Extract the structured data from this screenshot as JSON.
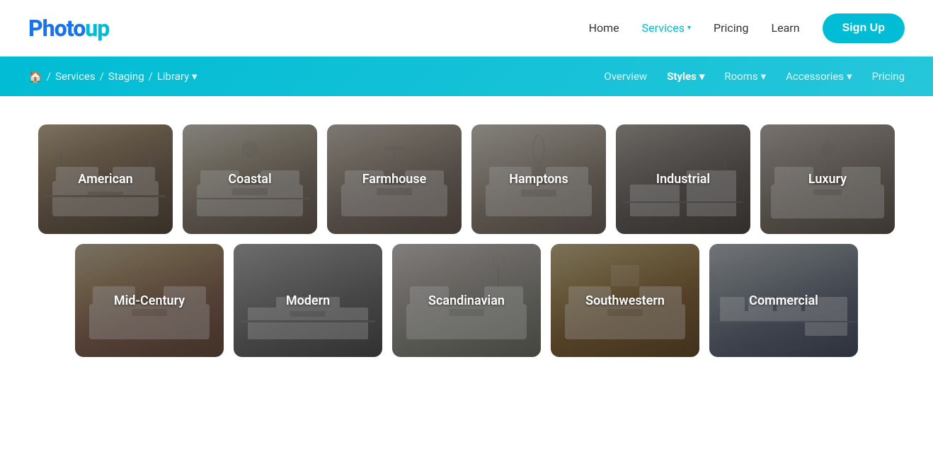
{
  "header": {
    "logo_text": "Photoup",
    "nav": [
      {
        "label": "Home",
        "active": false
      },
      {
        "label": "Services",
        "active": true,
        "has_arrow": true
      },
      {
        "label": "Pricing",
        "active": false
      },
      {
        "label": "Learn",
        "active": false
      }
    ],
    "signup_label": "Sign Up"
  },
  "subnav": {
    "breadcrumb": [
      {
        "label": "🏠",
        "type": "icon"
      },
      {
        "label": "/"
      },
      {
        "label": "Services"
      },
      {
        "label": "/"
      },
      {
        "label": "Staging"
      },
      {
        "label": "/"
      },
      {
        "label": "Library ▾"
      }
    ],
    "links": [
      {
        "label": "Overview",
        "bold": false
      },
      {
        "label": "Styles",
        "bold": true,
        "has_arrow": true
      },
      {
        "label": "Rooms",
        "bold": false,
        "has_arrow": true
      },
      {
        "label": "Accessories",
        "bold": false,
        "has_arrow": true
      },
      {
        "label": "Pricing",
        "bold": false
      }
    ]
  },
  "styles": {
    "row1": [
      {
        "label": "American",
        "bg": "american"
      },
      {
        "label": "Coastal",
        "bg": "coastal"
      },
      {
        "label": "Farmhouse",
        "bg": "farmhouse"
      },
      {
        "label": "Hamptons",
        "bg": "hamptons"
      },
      {
        "label": "Industrial",
        "bg": "industrial"
      },
      {
        "label": "Luxury",
        "bg": "luxury"
      }
    ],
    "row2": [
      {
        "label": "Mid-Century",
        "bg": "midcentury"
      },
      {
        "label": "Modern",
        "bg": "modern"
      },
      {
        "label": "Scandinavian",
        "bg": "scandinavian"
      },
      {
        "label": "Southwestern",
        "bg": "southwestern"
      },
      {
        "label": "Commercial",
        "bg": "commercial"
      }
    ]
  }
}
